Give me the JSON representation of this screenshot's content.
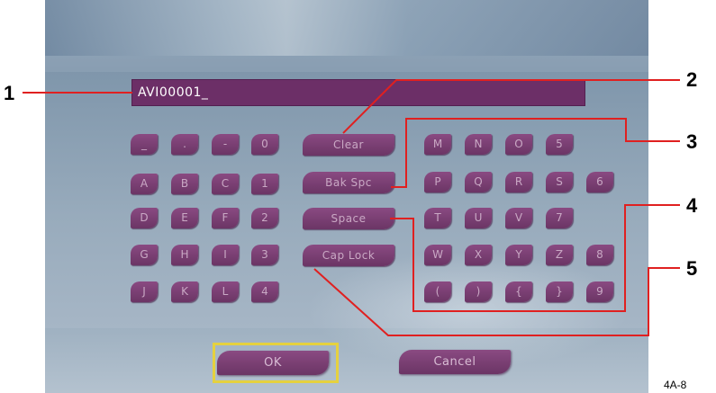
{
  "filename_input": {
    "value": "AVI00001_"
  },
  "left_keys": [
    [
      "_",
      ".",
      "-",
      "0"
    ],
    [
      "A",
      "B",
      "C",
      "1"
    ],
    [
      "D",
      "E",
      "F",
      "2"
    ],
    [
      "G",
      "H",
      "I",
      "3"
    ],
    [
      "J",
      "K",
      "L",
      "4"
    ]
  ],
  "function_keys": {
    "clear": "Clear",
    "backspace": "Bak Spc",
    "space": "Space",
    "caps_lock": "Cap Lock"
  },
  "right_keys": [
    [
      "M",
      "N",
      "O",
      "5"
    ],
    [
      "P",
      "Q",
      "R",
      "S",
      "6"
    ],
    [
      "T",
      "U",
      "V",
      "7"
    ],
    [
      "W",
      "X",
      "Y",
      "Z",
      "8"
    ],
    [
      "(",
      ")",
      "{",
      "}",
      "9"
    ]
  ],
  "buttons": {
    "ok": "OK",
    "cancel": "Cancel"
  },
  "callouts": [
    "1",
    "2",
    "3",
    "4",
    "5"
  ],
  "figure_ref": "4A-8",
  "colors": {
    "key": "#7a3f73",
    "input": "#6c2f67",
    "focus": "#e5d13f",
    "callout_line": "#e02020"
  }
}
